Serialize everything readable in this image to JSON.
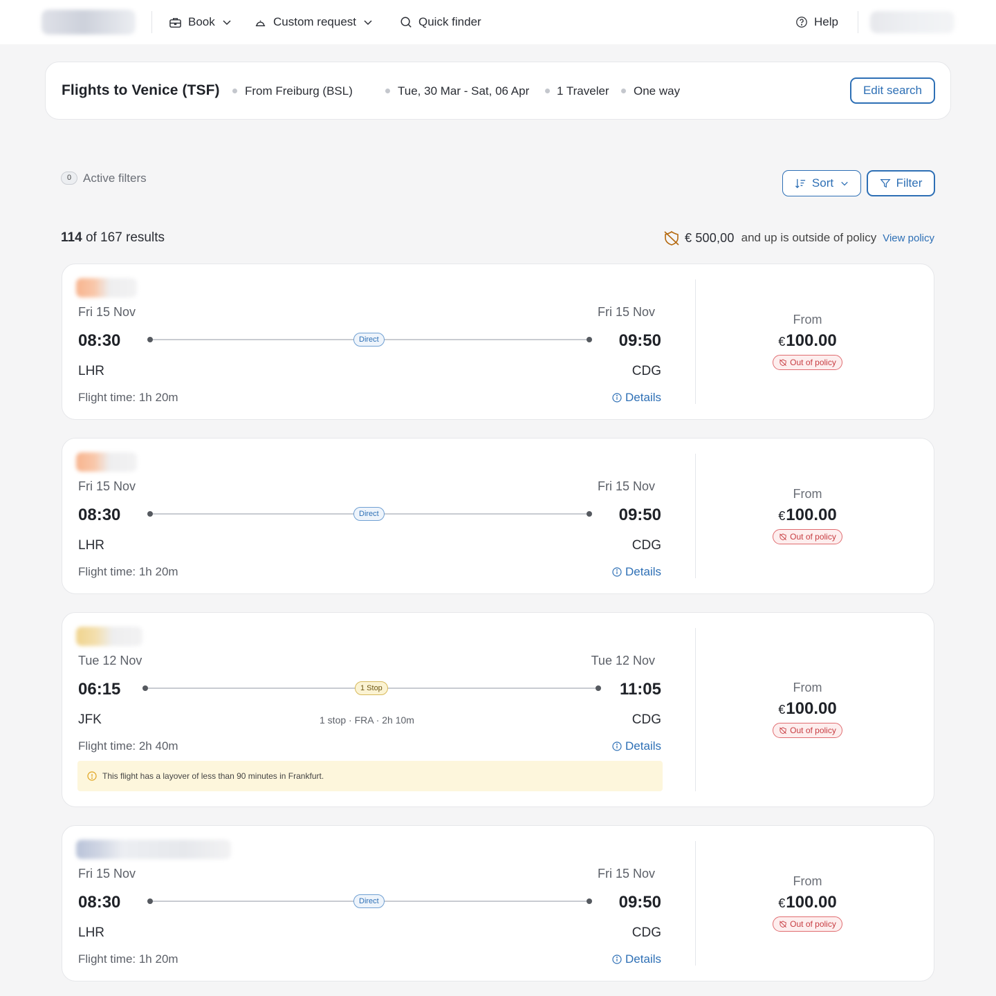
{
  "nav": {
    "book_label": "Book",
    "custom_request_label": "Custom request",
    "quick_finder_label": "Quick finder",
    "help_label": "Help"
  },
  "search": {
    "title": "Flights to Venice (TSF)",
    "from": "From Freiburg (BSL)",
    "dates": "Tue, 30 Mar - Sat, 06 Apr",
    "travelers": "1 Traveler",
    "trip_type": "One way",
    "edit_label": "Edit search"
  },
  "filters": {
    "active_count": "0",
    "active_label": "Active filters",
    "sort_label": "Sort",
    "filter_label": "Filter"
  },
  "results": {
    "shown": "114",
    "text": "of 167 results",
    "policy_amount": "€ 500,00",
    "policy_text": "and up is outside of policy",
    "policy_link": "View policy"
  },
  "colors": {
    "accent": "#2d6fb5",
    "out_of_policy": "#c73c41",
    "warning_bg": "#fdf6dc"
  },
  "flights": [
    {
      "dep_date": "Fri 15 Nov",
      "arr_date": "Fri 15 Nov",
      "dep_time": "08:30",
      "arr_time": "09:50",
      "dep_code": "LHR",
      "arr_code": "CDG",
      "stops_label": "Direct",
      "stop_info": "",
      "flight_time": "Flight time: 1h 20m",
      "details_label": "Details",
      "price_from": "From",
      "currency": "€",
      "price": "100.00",
      "policy_badge": "Out of policy",
      "warning": ""
    },
    {
      "dep_date": "Fri 15 Nov",
      "arr_date": "Fri 15 Nov",
      "dep_time": "08:30",
      "arr_time": "09:50",
      "dep_code": "LHR",
      "arr_code": "CDG",
      "stops_label": "Direct",
      "stop_info": "",
      "flight_time": "Flight time: 1h 20m",
      "details_label": "Details",
      "price_from": "From",
      "currency": "€",
      "price": "100.00",
      "policy_badge": "Out of policy",
      "warning": ""
    },
    {
      "dep_date": "Tue 12 Nov",
      "arr_date": "Tue 12 Nov",
      "dep_time": "06:15",
      "arr_time": "11:05",
      "dep_code": "JFK",
      "arr_code": "CDG",
      "stops_label": "1 Stop",
      "stop_info": "1 stop · FRA · 2h 10m",
      "flight_time": "Flight time: 2h 40m",
      "details_label": "Details",
      "price_from": "From",
      "currency": "€",
      "price": "100.00",
      "policy_badge": "Out of policy",
      "warning": "This flight has a layover of less than 90 minutes in Frankfurt."
    },
    {
      "dep_date": "Fri 15 Nov",
      "arr_date": "Fri 15 Nov",
      "dep_time": "08:30",
      "arr_time": "09:50",
      "dep_code": "LHR",
      "arr_code": "CDG",
      "stops_label": "Direct",
      "stop_info": "",
      "flight_time": "Flight time: 1h 20m",
      "details_label": "Details",
      "price_from": "From",
      "currency": "€",
      "price": "100.00",
      "policy_badge": "Out of policy",
      "warning": ""
    }
  ]
}
